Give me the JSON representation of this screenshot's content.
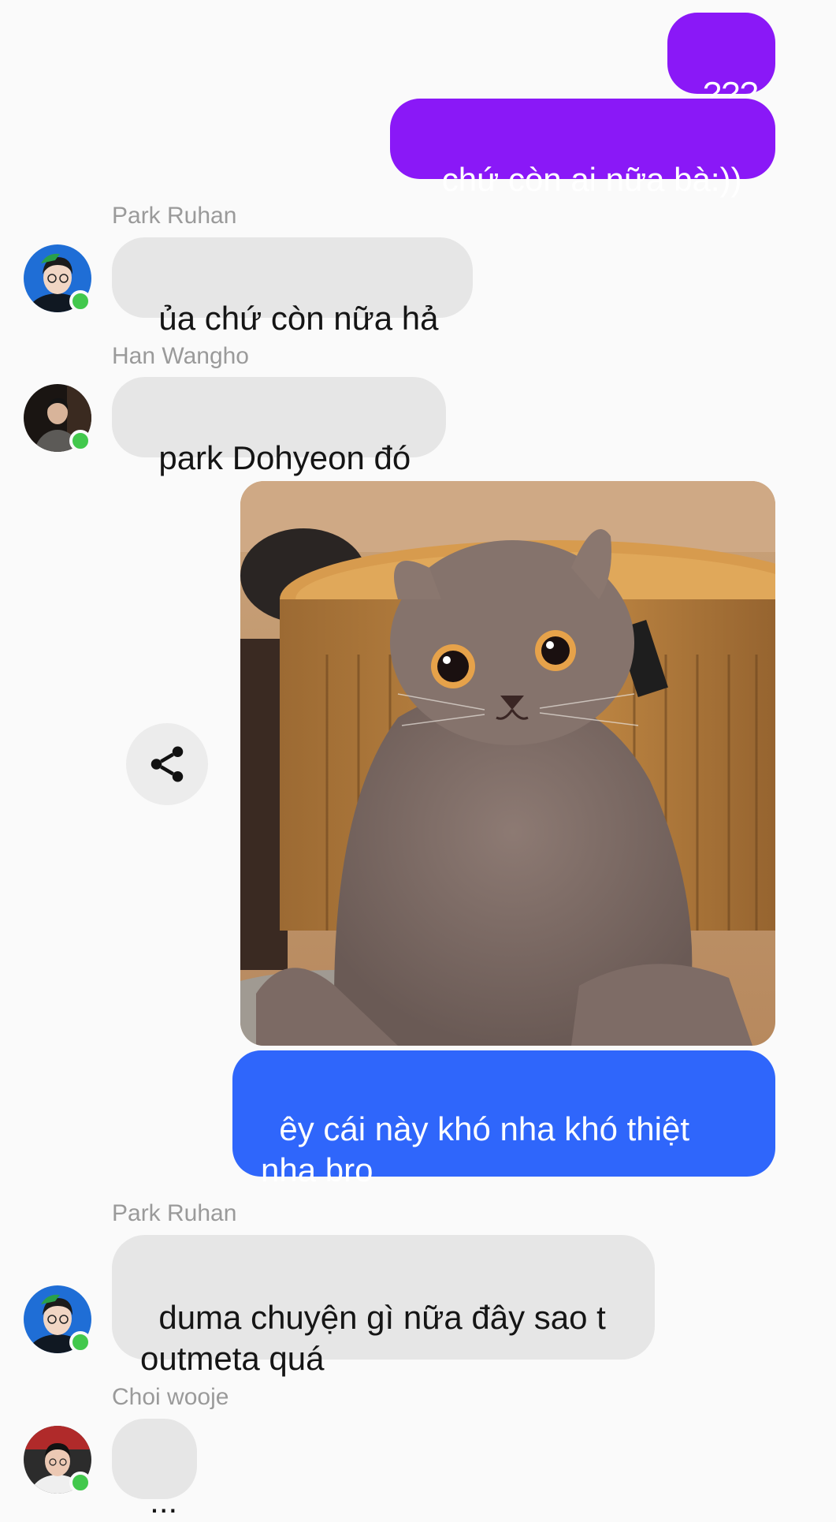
{
  "messages": {
    "m1": {
      "text": "???"
    },
    "m2": {
      "text": "chứ còn ai nữa bà:))"
    },
    "m3": {
      "sender": "Park Ruhan",
      "text": "ủa chứ còn nữa hả"
    },
    "m4": {
      "sender": "Han Wangho",
      "text": "park Dohyeon đó"
    },
    "m5": {
      "text": "êy cái này khó nha khó thiệt nha bro"
    },
    "m6": {
      "sender": "Park Ruhan",
      "text": "duma chuyện gì nữa đây sao t outmeta quá"
    },
    "m7": {
      "sender": "Choi wooje",
      "text": "..."
    }
  },
  "icons": {
    "share": "share-icon",
    "online": "online-status-dot"
  },
  "colors": {
    "outgoing_purple": "#8a18f7",
    "outgoing_blue": "#2f66fb",
    "incoming_bubble": "#e6e6e6",
    "online": "#42c84c",
    "sender_name": "#9a9a9a"
  }
}
